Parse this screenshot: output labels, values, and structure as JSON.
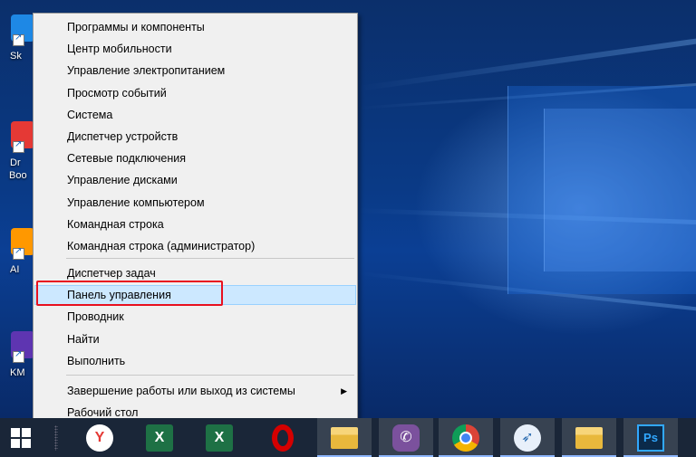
{
  "desktop_icons": [
    {
      "label": "Sk",
      "color": "#1e88e5",
      "icon": "skype-icon"
    },
    {
      "label": "Dr",
      "label2": "Boo",
      "color": "#e53935",
      "icon": "driver-booster-icon"
    },
    {
      "label": "AI",
      "color": "#ff9800",
      "icon": "aimp-icon"
    },
    {
      "label": "KM",
      "color": "#5e35b1",
      "icon": "kmplayer-icon"
    }
  ],
  "menu": {
    "groups": [
      {
        "items": [
          {
            "label": "Программы и компоненты"
          },
          {
            "label": "Центр мобильности"
          },
          {
            "label": "Управление электропитанием"
          },
          {
            "label": "Просмотр событий"
          },
          {
            "label": "Система"
          },
          {
            "label": "Диспетчер устройств"
          },
          {
            "label": "Сетевые подключения"
          },
          {
            "label": "Управление дисками"
          },
          {
            "label": "Управление компьютером"
          },
          {
            "label": "Командная строка"
          },
          {
            "label": "Командная строка (администратор)"
          }
        ]
      },
      {
        "items": [
          {
            "label": "Диспетчер задач"
          },
          {
            "label": "Панель управления",
            "highlighted": true
          },
          {
            "label": "Проводник"
          },
          {
            "label": "Найти"
          },
          {
            "label": "Выполнить"
          }
        ]
      },
      {
        "items": [
          {
            "label": "Завершение работы или выход из системы",
            "submenu": true
          },
          {
            "label": "Рабочий стол"
          }
        ]
      }
    ],
    "submenu_arrow": "▶"
  },
  "taskbar": {
    "apps": [
      {
        "name": "yandex-browser",
        "icon": "yandex-icon",
        "glyph": "Y",
        "color": "#e53935",
        "active": false
      },
      {
        "name": "excel",
        "icon": "excel-icon",
        "glyph": "X",
        "color": "#1e7145",
        "active": false
      },
      {
        "name": "excel-2",
        "icon": "excel-sheet-icon",
        "glyph": "X",
        "color": "#1e7145",
        "active": false
      },
      {
        "name": "opera",
        "icon": "opera-icon",
        "glyph": "O",
        "color": "#d50000",
        "active": false
      },
      {
        "name": "file-explorer",
        "icon": "folder-icon",
        "glyph": "",
        "color": "#f2c14e",
        "active": true
      },
      {
        "name": "viber",
        "icon": "viber-icon",
        "glyph": "✆",
        "color": "#7b519d",
        "active": true
      },
      {
        "name": "chrome",
        "icon": "chrome-icon",
        "glyph": "",
        "color": "#4caf50",
        "active": true
      },
      {
        "name": "messenger",
        "icon": "swallow-icon",
        "glyph": "➶",
        "color": "#2b6cb0",
        "active": true
      },
      {
        "name": "file-explorer-2",
        "icon": "folder-icon",
        "glyph": "",
        "color": "#f2c14e",
        "active": true
      },
      {
        "name": "photoshop",
        "icon": "photoshop-icon",
        "glyph": "Ps",
        "color": "#0b2a4a",
        "active": true
      }
    ]
  }
}
